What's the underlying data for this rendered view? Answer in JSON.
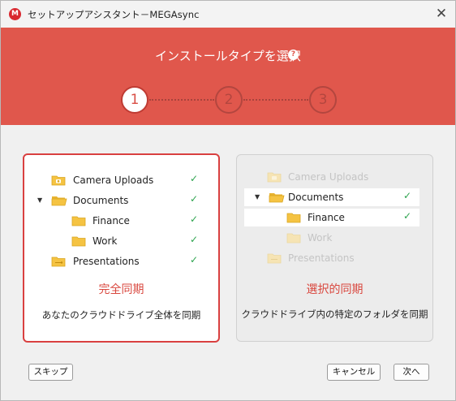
{
  "window": {
    "app_icon_letter": "M",
    "title": "セットアップアシスタント－MEGAsync",
    "close_glyph": "✕"
  },
  "header": {
    "title": "インストールタイプを選択",
    "help_glyph": "?",
    "steps": [
      "1",
      "2",
      "3"
    ],
    "active_step": 1
  },
  "full_sync": {
    "items": [
      {
        "label": "Camera Uploads",
        "icon": "camera-folder-icon"
      },
      {
        "label": "Documents",
        "icon": "folder-open-icon"
      },
      {
        "label": "Finance",
        "icon": "folder-icon"
      },
      {
        "label": "Work",
        "icon": "folder-icon"
      },
      {
        "label": "Presentations",
        "icon": "presentation-folder-icon"
      }
    ],
    "title": "完全同期",
    "description": "あなたのクラウドドライブ全体を同期"
  },
  "selective_sync": {
    "items": [
      {
        "label": "Camera Uploads",
        "icon": "camera-folder-icon"
      },
      {
        "label": "Documents",
        "icon": "folder-open-icon"
      },
      {
        "label": "Finance",
        "icon": "folder-icon"
      },
      {
        "label": "Work",
        "icon": "folder-icon"
      },
      {
        "label": "Presentations",
        "icon": "presentation-folder-icon"
      }
    ],
    "title": "選択的同期",
    "description": "クラウドドライブ内の特定のフォルダを同期"
  },
  "buttons": {
    "skip": "スキップ",
    "cancel": "キャンセル",
    "next": "次へ"
  },
  "colors": {
    "header": "#e0574c",
    "accent": "#d9473e",
    "check": "#2ea44f",
    "folder": "#f5c342"
  }
}
